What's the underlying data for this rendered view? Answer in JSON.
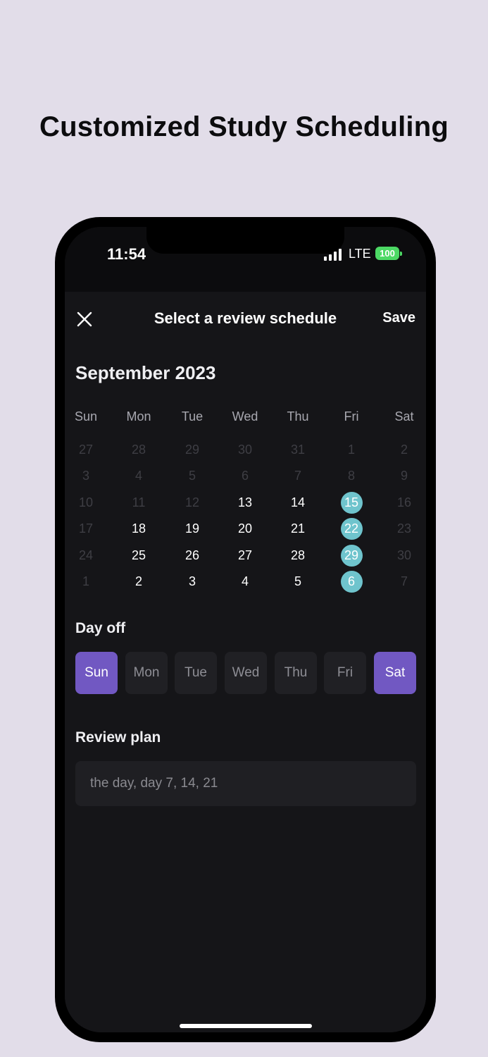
{
  "headline": "Customized Study Scheduling",
  "status_bar": {
    "time": "11:54",
    "network": "LTE",
    "battery": "100"
  },
  "nav": {
    "title": "Select a review schedule",
    "save_label": "Save",
    "close_icon": "close-icon"
  },
  "calendar": {
    "month_title": "September 2023",
    "weekdays": [
      "Sun",
      "Mon",
      "Tue",
      "Wed",
      "Thu",
      "Fri",
      "Sat"
    ],
    "weeks": [
      [
        {
          "d": "27",
          "s": "muted"
        },
        {
          "d": "28",
          "s": "muted"
        },
        {
          "d": "29",
          "s": "muted"
        },
        {
          "d": "30",
          "s": "muted"
        },
        {
          "d": "31",
          "s": "muted"
        },
        {
          "d": "1",
          "s": "muted"
        },
        {
          "d": "2",
          "s": "muted"
        }
      ],
      [
        {
          "d": "3",
          "s": "muted"
        },
        {
          "d": "4",
          "s": "muted"
        },
        {
          "d": "5",
          "s": "muted"
        },
        {
          "d": "6",
          "s": "muted"
        },
        {
          "d": "7",
          "s": "muted"
        },
        {
          "d": "8",
          "s": "muted"
        },
        {
          "d": "9",
          "s": "muted"
        }
      ],
      [
        {
          "d": "10",
          "s": "muted"
        },
        {
          "d": "11",
          "s": "muted"
        },
        {
          "d": "12",
          "s": "muted"
        },
        {
          "d": "13",
          "s": "active"
        },
        {
          "d": "14",
          "s": "active"
        },
        {
          "d": "15",
          "s": "selected"
        },
        {
          "d": "16",
          "s": "muted"
        }
      ],
      [
        {
          "d": "17",
          "s": "muted"
        },
        {
          "d": "18",
          "s": "active"
        },
        {
          "d": "19",
          "s": "active"
        },
        {
          "d": "20",
          "s": "active"
        },
        {
          "d": "21",
          "s": "active"
        },
        {
          "d": "22",
          "s": "selected"
        },
        {
          "d": "23",
          "s": "muted"
        }
      ],
      [
        {
          "d": "24",
          "s": "muted"
        },
        {
          "d": "25",
          "s": "active"
        },
        {
          "d": "26",
          "s": "active"
        },
        {
          "d": "27",
          "s": "active"
        },
        {
          "d": "28",
          "s": "active"
        },
        {
          "d": "29",
          "s": "selected"
        },
        {
          "d": "30",
          "s": "muted"
        }
      ],
      [
        {
          "d": "1",
          "s": "muted"
        },
        {
          "d": "2",
          "s": "active"
        },
        {
          "d": "3",
          "s": "active"
        },
        {
          "d": "4",
          "s": "active"
        },
        {
          "d": "5",
          "s": "active"
        },
        {
          "d": "6",
          "s": "selected"
        },
        {
          "d": "7",
          "s": "muted"
        }
      ]
    ],
    "selected_color": "#6fc4cd"
  },
  "day_off": {
    "label": "Day off",
    "options": [
      {
        "label": "Sun",
        "selected": true
      },
      {
        "label": "Mon",
        "selected": false
      },
      {
        "label": "Tue",
        "selected": false
      },
      {
        "label": "Wed",
        "selected": false
      },
      {
        "label": "Thu",
        "selected": false
      },
      {
        "label": "Fri",
        "selected": false
      },
      {
        "label": "Sat",
        "selected": true
      }
    ],
    "selected_color": "#7158c2"
  },
  "review_plan": {
    "label": "Review plan",
    "value": "the day, day 7, 14, 21"
  }
}
